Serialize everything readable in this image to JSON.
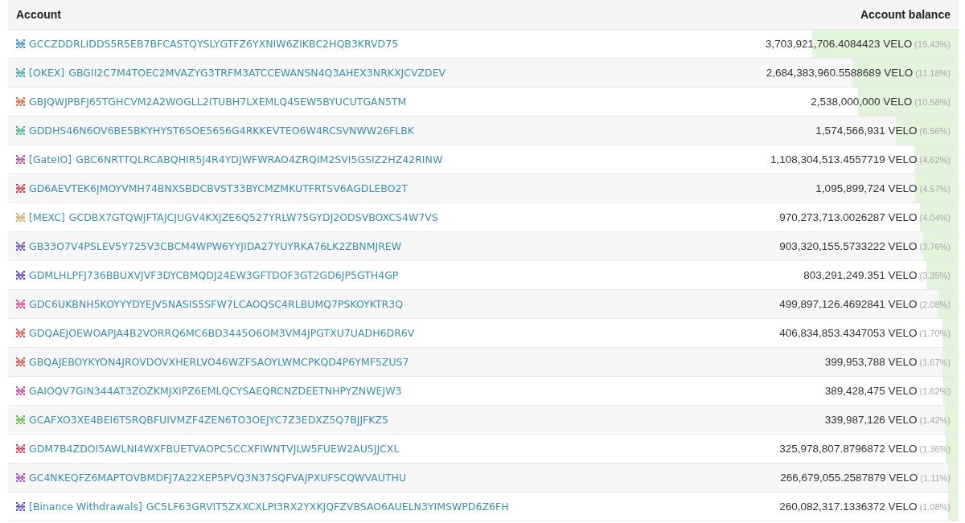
{
  "table": {
    "columns": [
      "Account",
      "Account balance"
    ],
    "rows": [
      {
        "color": "#3a8fc4",
        "address": "GCCZDDRLIDDS5R5EB7BFCASTQYSLYGTFZ6YXNIW6ZIKBC2HQB3KRVD75",
        "balance": "3,703,921,706.4084423 VELO",
        "share": "(15.43%)",
        "level": 0.1543
      },
      {
        "color": "#45a8b0",
        "label": "[OKEX]",
        "address": "GBGII2C7M4TOEC2MVAZYG3TRFM3ATCCEWANSN4Q3AHEX3NRKXJCVZDEV",
        "balance": "2,684,383,960.5588689 VELO",
        "share": "(11.18%)",
        "level": 0.1118
      },
      {
        "color": "#d9683a",
        "address": "GBJQWJPBFJ65TGHCVM2A2WOGLL2ITUBH7LXEMLQ4SEW5BYUCUTGAN5TM",
        "balance": "2,538,000,000 VELO",
        "share": "(10.58%)",
        "level": 0.1058
      },
      {
        "color": "#4ab39a",
        "address": "GDDHS46N6OV6BE5BKYHYST6SOE5656G4RKKEVTEO6W4RCSVNWW26FLBK",
        "balance": "1,574,566,931 VELO",
        "share": "(6.56%)",
        "level": 0.0656
      },
      {
        "color": "#c2479a",
        "label": "[GateIO]",
        "address": "GBC6NRTTQLRCABQHIR5J4R4YDJWFWRAO4ZRQIM2SVI5GSIZ2HZ42RINW",
        "balance": "1,108,304,513.4557719 VELO",
        "share": "(4.62%)",
        "level": 0.0462
      },
      {
        "color": "#c94040",
        "address": "GD6AEVTEK6JMOYVMH74BNXSBDCBVST33BYCMZMKUTFRTSV6AGDLEBO2T",
        "balance": "1,095,899,724 VELO",
        "share": "(4.57%)",
        "level": 0.0457
      },
      {
        "color": "#d4a55a",
        "label": "[MEXC]",
        "address": "GCDBX7GTQWJFTAJCJUGV4KXJZE6Q527YRLW75GYDJ2ODSVBOXCS4W7VS",
        "balance": "970,273,713.0026287 VELO",
        "share": "(4.04%)",
        "level": 0.0404
      },
      {
        "color": "#6a4fc4",
        "address": "GB33O7V4PSLEV5Y725V3CBCM4WPW6YYJIDA27YUYRKA76LK2ZBNMJREW",
        "balance": "903,320,155.5733222 VELO",
        "share": "(3.76%)",
        "level": 0.0376
      },
      {
        "color": "#5a3fc4",
        "address": "GDMLHLPFJ736BBUXVJVF3DYCBMQDJ24EW3GFTDOF3GT2GD6JP5GTH4GP",
        "balance": "803,291,249.351 VELO",
        "share": "(3.35%)",
        "level": 0.0335
      },
      {
        "color": "#d6479a",
        "address": "GDC6UKBNH5KOYYYDYEJV5NASIS5SFW7LCAOQSC4RLBUMQ7PSKOYKTR3Q",
        "balance": "499,897,126.4692841 VELO",
        "share": "(2.08%)",
        "level": 0.0208
      },
      {
        "color": "#d9504a",
        "address": "GDQAEJOEWOAPJA4B2VORRQ6MC6BD3445O6OM3VM4JPGTXU7UADH6DR6V",
        "balance": "406,834,853.4347053 VELO",
        "share": "(1.70%)",
        "level": 0.017
      },
      {
        "color": "#d9503a",
        "address": "GBQAJEBOYKYON4JROVDOVXHERLVO46WZFSAOYLWMCPKQD4P6YMF5ZUS7",
        "balance": "399,953,788 VELO",
        "share": "(1.67%)",
        "level": 0.0167
      },
      {
        "color": "#b8479a",
        "address": "GAIOQV7GIN344AT3ZOZKMJXIPZ6EMLQCYSAEQRCNZDEETNHPYZNWEJW3",
        "balance": "389,428,475 VELO",
        "share": "(1.62%)",
        "level": 0.0162
      },
      {
        "color": "#6ab84a",
        "address": "GCAFXO3XE4BEI6TSRQBFUIVMZF4ZEN6TO3OEJYC7Z3EDXZ5Q7BJJFKZ5",
        "balance": "339,987,126 VELO",
        "share": "(1.42%)",
        "level": 0.0142
      },
      {
        "color": "#c2405a",
        "address": "GDM7B4ZDOI5AWLNI4WXFBUETVAOPC5CCXFIWNTVJLW5FUEW2AUSJJCXL",
        "balance": "325,978,807.8796872 VELO",
        "share": "(1.36%)",
        "level": 0.0136
      },
      {
        "color": "#b04fc4",
        "address": "GC4NKEQFZ6MAPTOVBMDFJ7A22XEP5PVQ3N37SQFVAJPXUFSCQWVAUTHU",
        "balance": "266,679,055.2587879 VELO",
        "share": "(1.11%)",
        "level": 0.0111
      },
      {
        "color": "#5a4fc4",
        "label": "[Binance Withdrawals]",
        "address": "GC5LF63GRVIT5ZXXCXLPI3RX2YXKJQFZVBSAO6AUELN3YIMSWPD6Z6FH",
        "balance": "260,082,317.1336372 VELO",
        "share": "(1.08%)",
        "level": 0.0108
      }
    ]
  }
}
